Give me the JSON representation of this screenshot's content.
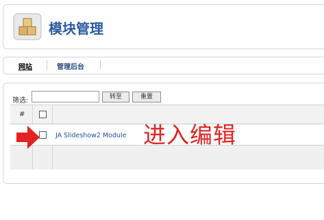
{
  "header": {
    "title": "模块管理",
    "icon": "module-boxes-icon"
  },
  "tabs": [
    {
      "label": "网站"
    },
    {
      "label": "管理后台"
    }
  ],
  "filter": {
    "label": "筛选:",
    "value": "",
    "go_label": "转至",
    "reset_label": "重置"
  },
  "table": {
    "columns": [
      "#"
    ],
    "rows": [
      {
        "name": "JA Slideshow2 Module"
      }
    ]
  },
  "annotation": {
    "text": "进入编辑",
    "color": "#e32222",
    "arrow": "red-arrow-icon"
  }
}
